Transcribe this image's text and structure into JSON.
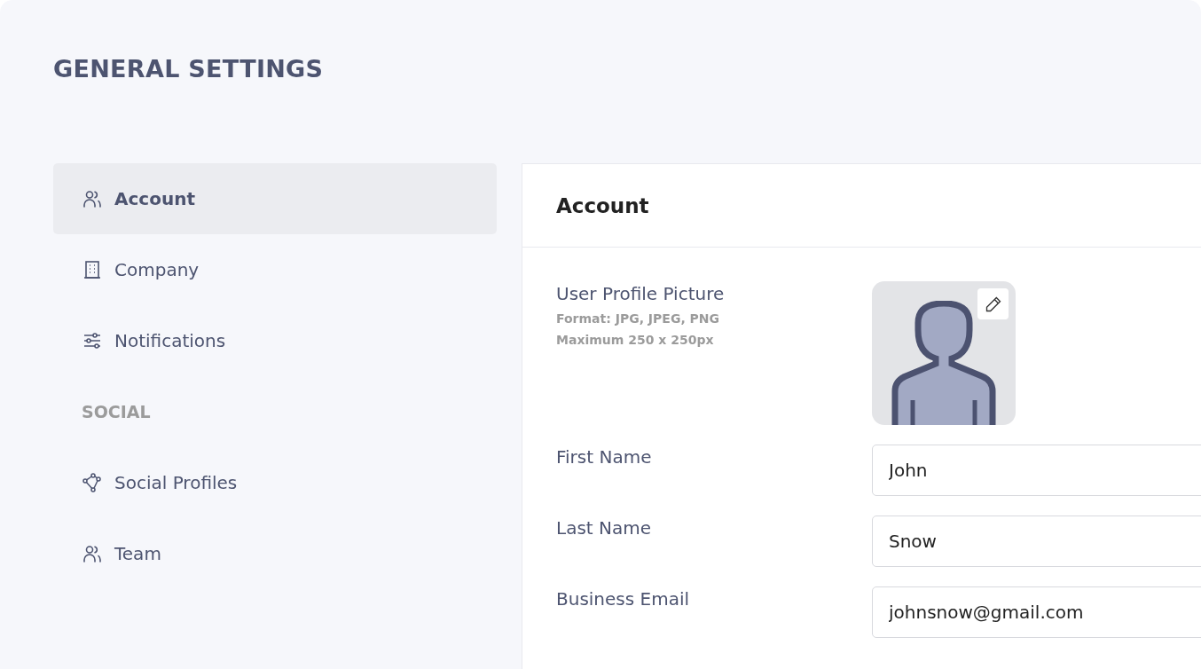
{
  "title": "GENERAL SETTINGS",
  "sidebar": {
    "items": [
      {
        "kind": "link",
        "label": "Account",
        "selected": true
      },
      {
        "kind": "link",
        "label": "Company",
        "selected": false
      },
      {
        "kind": "link",
        "label": "Notifications",
        "selected": false
      },
      {
        "kind": "section",
        "label": "SOCIAL"
      },
      {
        "kind": "link",
        "label": "Social Profiles",
        "selected": false
      },
      {
        "kind": "link",
        "label": "Team",
        "selected": false
      }
    ]
  },
  "panel": {
    "title": "Account",
    "picture": {
      "label": "User Profile Picture",
      "hints": [
        "Format: JPG, JPEG, PNG",
        "Maximum 250 x 250px"
      ]
    },
    "fields": [
      {
        "label": "First Name",
        "value": "John"
      },
      {
        "label": "Last Name",
        "value": "Snow"
      },
      {
        "label": "Business Email",
        "value": "johnsnow@gmail.com"
      }
    ]
  }
}
